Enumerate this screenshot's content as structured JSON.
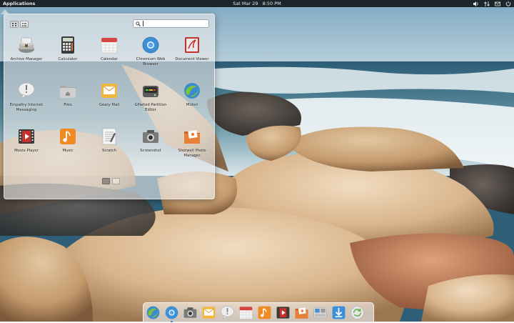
{
  "panel": {
    "applications_label": "Applications",
    "date": "Sat Mar 29",
    "time": "8:50 PM",
    "indicators": [
      "volume-icon",
      "network-icon",
      "mail-icon",
      "power-icon"
    ]
  },
  "launcher": {
    "search_value": "",
    "view_modes": [
      "grid-view-icon",
      "category-view-icon"
    ],
    "apps": [
      {
        "label": "Archive Manager",
        "icon": "archive-icon"
      },
      {
        "label": "Calculator",
        "icon": "calculator-icon"
      },
      {
        "label": "Calendar",
        "icon": "calendar-icon"
      },
      {
        "label": "Chromium Web Browser",
        "icon": "chromium-icon"
      },
      {
        "label": "Document Viewer",
        "icon": "document-viewer-icon"
      },
      {
        "label": "Empathy Internet Messaging",
        "icon": "empathy-icon"
      },
      {
        "label": "Files",
        "icon": "files-icon"
      },
      {
        "label": "Geary Mail",
        "icon": "geary-mail-icon"
      },
      {
        "label": "GParted Partition Editor",
        "icon": "gparted-icon"
      },
      {
        "label": "Midori",
        "icon": "midori-icon"
      },
      {
        "label": "Movie Player",
        "icon": "movie-player-icon"
      },
      {
        "label": "Music",
        "icon": "music-icon"
      },
      {
        "label": "Scratch",
        "icon": "scratch-icon"
      },
      {
        "label": "Screenshot",
        "icon": "screenshot-icon"
      },
      {
        "label": "Shotwell Photo Manager",
        "icon": "shotwell-icon"
      }
    ],
    "pages": 2,
    "current_page": 1
  },
  "dock": {
    "items": [
      "midori-icon",
      "chromium-icon",
      "screenshot-icon",
      "geary-mail-icon",
      "empathy-icon",
      "calendar-icon",
      "music-icon",
      "movie-player-icon",
      "shotwell-icon",
      "system-settings-icon",
      "software-updates-icon",
      "update-manager-icon"
    ],
    "running": [
      "chromium-icon"
    ]
  },
  "colors": {
    "panel_bg": "#1a1a1a",
    "accent": "#2a7fd4"
  }
}
